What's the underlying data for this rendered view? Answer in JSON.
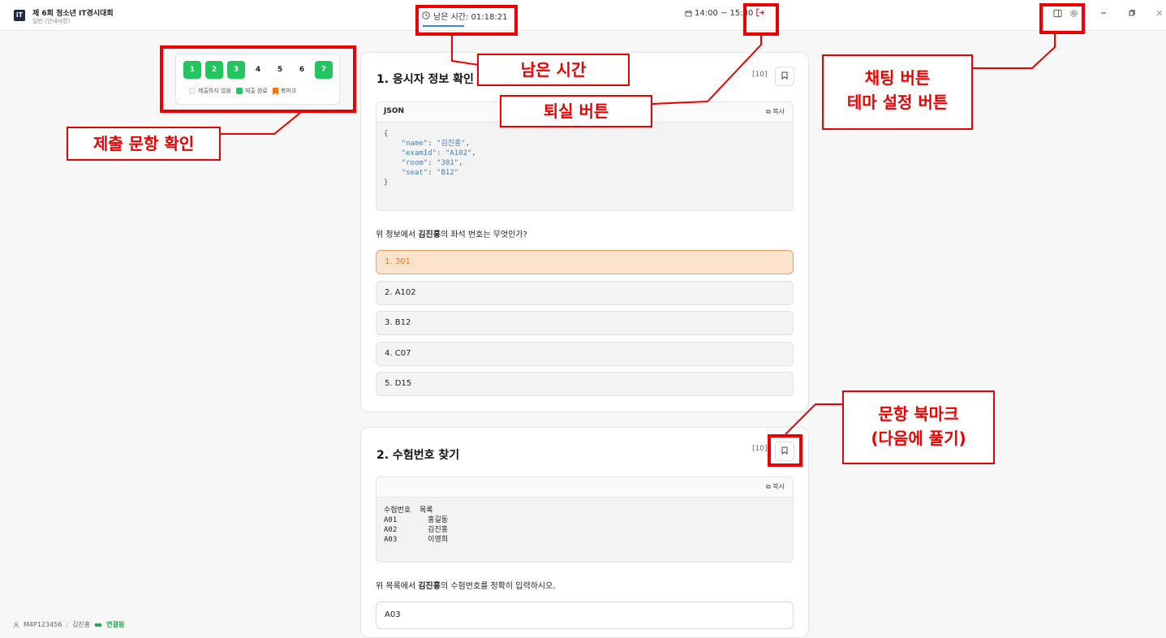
{
  "app": {
    "title": "제 6회 청소년 IT경시대회",
    "subtitle": "일반 (안내사항)",
    "logo": "iT"
  },
  "header": {
    "timer_label": "남은 시간: 01:18:21",
    "schedule": "14:00 ~ 15:30",
    "icons": [
      "clock-icon",
      "calendar-icon",
      "exit-icon",
      "chat-panel-icon",
      "gear-icon",
      "minimize-icon",
      "restore-icon",
      "close-icon"
    ]
  },
  "nav": {
    "questions": [
      {
        "num": "1",
        "state": "done"
      },
      {
        "num": "2",
        "state": "done"
      },
      {
        "num": "3",
        "state": "done"
      },
      {
        "num": "4",
        "state": "todo"
      },
      {
        "num": "5",
        "state": "todo"
      },
      {
        "num": "6",
        "state": "todo"
      },
      {
        "num": "7",
        "state": "done"
      }
    ],
    "legend": {
      "unsubmitted": "제출하지 않음",
      "submitted": "제출 완료",
      "bookmark": "북마크"
    },
    "colors": {
      "submitted": "#22c55e",
      "bookmark": "#f97316"
    }
  },
  "annotations": {
    "remaining_time": "남은 시간",
    "exit_button": "퇴실 버튼",
    "chat_button": "채팅 버튼",
    "theme_button": "테마 설정 버튼",
    "submission_check": "제출 문항 확인",
    "bookmark_line1": "문항 북마크",
    "bookmark_line2": "(다음에 풀기)",
    "color": "#ee0000"
  },
  "q1": {
    "title": "1. 응시자 정보 확인",
    "points": "[10]",
    "code_lang": "JSON",
    "copy_label": "복사",
    "code": {
      "open": "{",
      "close": "}",
      "lines": [
        {
          "key": "\"name\"",
          "value": "\"김진홍\"",
          "tail": ","
        },
        {
          "key": "\"examId\"",
          "value": "\"A102\"",
          "tail": ","
        },
        {
          "key": "\"room\"",
          "value": "\"301\"",
          "tail": ","
        },
        {
          "key": "\"seat\"",
          "value": "\"B12\"",
          "tail": ""
        }
      ]
    },
    "text_pre": "위 정보에서 ",
    "text_bold": "김진홍",
    "text_post": "의 좌석 번호는 무엇인가?",
    "options": [
      "1. 301",
      "2. A102",
      "3. B12",
      "4. C07",
      "5. D15"
    ],
    "selected": 0
  },
  "q2": {
    "title": "2. 수험번호 찾기",
    "points": "[10]",
    "copy_label": "복사",
    "code_lines": [
      "수험번호  목록",
      "A01       홍길동",
      "A02       김진홍",
      "A03       이영희"
    ],
    "text_pre": "위 목록에서 ",
    "text_bold": "김진홍",
    "text_post": "의 수험번호를 정확히 입력하시오.",
    "answer": "A03"
  },
  "status": {
    "user_id": "M4P123456",
    "name": "김진홍",
    "connection": "연결됨"
  }
}
